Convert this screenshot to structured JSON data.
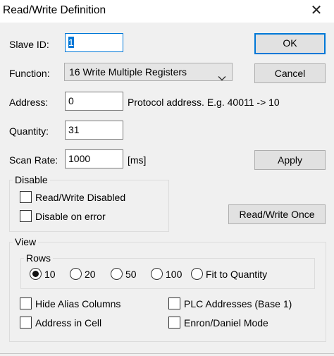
{
  "window": {
    "title": "Read/Write Definition"
  },
  "fields": {
    "slave_id": {
      "label": "Slave ID:",
      "value": "1"
    },
    "function": {
      "label": "Function:",
      "value": "16 Write Multiple Registers"
    },
    "address": {
      "label": "Address:",
      "value": "0",
      "hint": "Protocol address. E.g. 40011 -> 10"
    },
    "quantity": {
      "label": "Quantity:",
      "value": "31"
    },
    "scan_rate": {
      "label": "Scan Rate:",
      "value": "1000",
      "unit": "[ms]"
    }
  },
  "buttons": {
    "ok": "OK",
    "cancel": "Cancel",
    "apply": "Apply",
    "read_write_once": "Read/Write Once"
  },
  "disable_group": {
    "label": "Disable",
    "read_write_disabled": {
      "label": "Read/Write Disabled",
      "checked": false
    },
    "disable_on_error": {
      "label": "Disable on error",
      "checked": false
    }
  },
  "view_group": {
    "label": "View",
    "rows": {
      "label": "Rows",
      "options": [
        "10",
        "20",
        "50",
        "100",
        "Fit to Quantity"
      ],
      "selected": "10"
    },
    "hide_alias_columns": {
      "label": "Hide Alias Columns",
      "checked": false
    },
    "plc_addresses": {
      "label": "PLC Addresses (Base 1)",
      "checked": false
    },
    "address_in_cell": {
      "label": "Address in Cell",
      "checked": false
    },
    "enron_daniel_mode": {
      "label": "Enron/Daniel Mode",
      "checked": false
    }
  },
  "icons": {
    "close": "close-icon",
    "dropdown": "chevron-down-icon"
  }
}
